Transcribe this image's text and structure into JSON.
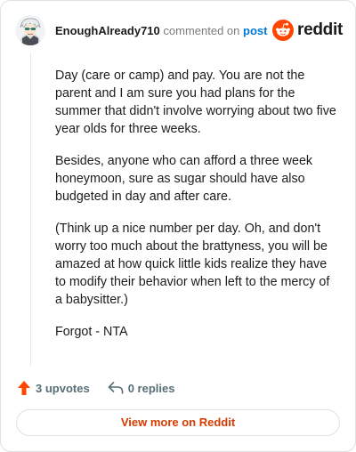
{
  "comment": {
    "author": "EnoughAlready710",
    "commented_text": "commented on",
    "post_link": "post",
    "paragraphs": [
      "Day (care or camp) and pay. You are not the parent and I am sure you had plans for the summer that didn't involve worrying about two five year olds for three weeks.",
      "Besides, anyone who can afford a three week honeymoon, sure as sugar should have also budgeted in day and after care.",
      "(Think up a nice number per day. Oh, and don't worry too much about the brattyness, you will be amazed at how quick little kids realize they have to modify their behavior when left to the mercy of a babysitter.)",
      "Forgot - NTA"
    ]
  },
  "brand": {
    "name": "reddit",
    "accent_color": "#ff4500"
  },
  "actions": {
    "upvotes_label": "3 upvotes",
    "replies_label": "0 replies",
    "upvote_icon": "upvote-arrow-icon",
    "reply_icon": "reply-arrow-icon"
  },
  "footer": {
    "view_more_label": "View more on Reddit"
  }
}
